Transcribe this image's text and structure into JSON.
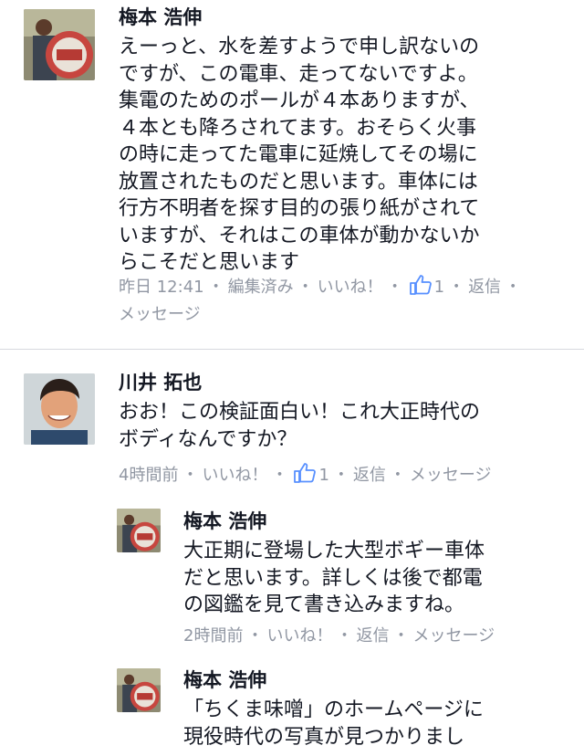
{
  "comments": [
    {
      "author": "梅本 浩伸",
      "text": "えーっと、水を差すようで申し訳ないの\nですが、この電車、走ってないですよ。\n集電のためのポールが４本ありますが、\n４本とも降ろされてます。おそらく火事\nの時に走ってた電車に延焼してその場に\n放置されたものだと思います。車体には\n行方不明者を探す目的の張り紙がされて\nいますが、それはこの車体が動かないか\nらこそだと思います",
      "time": "昨日 12:41",
      "edited": "編集済み",
      "like": "いいね！",
      "like_count": "1",
      "reply": "返信",
      "message": "メッセージ"
    },
    {
      "author": "川井 拓也",
      "text": "おお！この検証面白い！これ大正時代の\nボディなんですか？",
      "time": "4時間前",
      "like": "いいね！",
      "like_count": "1",
      "reply": "返信",
      "message": "メッセージ"
    },
    {
      "author": "梅本 浩伸",
      "text": "大正期に登場した大型ボギー車体\nだと思います。詳しくは後で都電\nの図鑑を見て書き込みますね。",
      "time": "2時間前",
      "like": "いいね！",
      "reply": "返信",
      "message": "メッセージ"
    },
    {
      "author": "梅本 浩伸",
      "text": "「ちくま味噌」のホームページに\n現役時代の写真が見つかりまし"
    }
  ],
  "separator": "・",
  "colors": {
    "meta": "#9197a3",
    "like_icon": "#5890ff",
    "divider": "#d7d9de"
  }
}
